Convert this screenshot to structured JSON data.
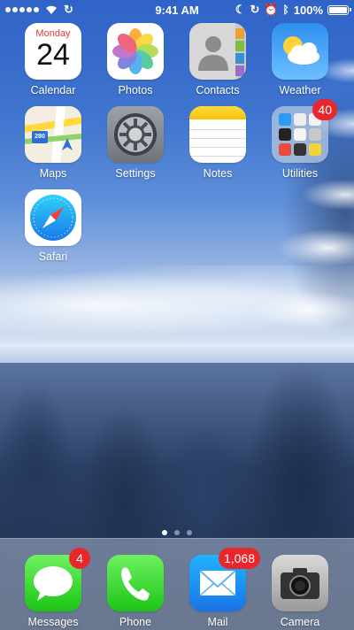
{
  "status_bar": {
    "signal_bars": 5,
    "time": "9:41 AM",
    "battery_percent": "100%",
    "battery_level": 1.0
  },
  "apps": [
    {
      "id": "calendar",
      "label": "Calendar",
      "icon": "calendar-icon",
      "day": "Monday",
      "date": "24"
    },
    {
      "id": "photos",
      "label": "Photos",
      "icon": "photos-icon"
    },
    {
      "id": "contacts",
      "label": "Contacts",
      "icon": "contacts-icon"
    },
    {
      "id": "weather",
      "label": "Weather",
      "icon": "weather-icon"
    },
    {
      "id": "maps",
      "label": "Maps",
      "icon": "maps-icon",
      "road_sign": "280"
    },
    {
      "id": "settings",
      "label": "Settings",
      "icon": "settings-icon"
    },
    {
      "id": "notes",
      "label": "Notes",
      "icon": "notes-icon"
    },
    {
      "id": "utilities",
      "label": "Utilities",
      "icon": "folder-icon",
      "badge": "40"
    },
    {
      "id": "safari",
      "label": "Safari",
      "icon": "safari-icon"
    }
  ],
  "page_dots": {
    "count": 3,
    "active": 0
  },
  "dock": [
    {
      "id": "messages",
      "label": "Messages",
      "icon": "messages-icon",
      "badge": "4"
    },
    {
      "id": "phone",
      "label": "Phone",
      "icon": "phone-icon"
    },
    {
      "id": "mail",
      "label": "Mail",
      "icon": "mail-icon",
      "badge": "1,068"
    },
    {
      "id": "camera",
      "label": "Camera",
      "icon": "camera-icon"
    }
  ],
  "colors": {
    "badge": "#e8262b",
    "calendar_day": "#e23b2e"
  }
}
